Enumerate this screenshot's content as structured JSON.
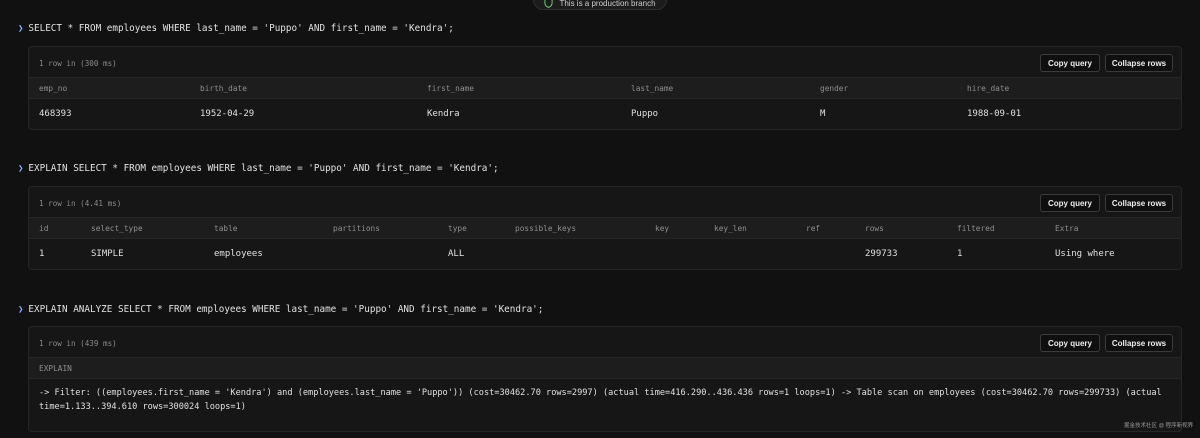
{
  "banner": {
    "text": "This is a production branch",
    "icon": "shield-icon"
  },
  "queries": [
    {
      "sql": "SELECT * FROM employees WHERE last_name = 'Puppo' AND first_name = 'Kendra';",
      "meta": "1 row in (300 ms)",
      "copy_label": "Copy query",
      "collapse_label": "Collapse rows",
      "columns": [
        "emp_no",
        "birth_date",
        "first_name",
        "last_name",
        "gender",
        "hire_date"
      ],
      "rows": [
        [
          "468393",
          "1952-04-29",
          "Kendra",
          "Puppo",
          "M",
          "1988-09-01"
        ]
      ]
    },
    {
      "sql": "EXPLAIN SELECT * FROM employees WHERE last_name = 'Puppo' AND first_name = 'Kendra';",
      "meta": "1 row in (4.41 ms)",
      "copy_label": "Copy query",
      "collapse_label": "Collapse rows",
      "columns": [
        "id",
        "select_type",
        "table",
        "partitions",
        "type",
        "possible_keys",
        "key",
        "key_len",
        "ref",
        "rows",
        "filtered",
        "Extra"
      ],
      "rows": [
        [
          "1",
          "SIMPLE",
          "employees",
          "",
          "ALL",
          "",
          "",
          "",
          "",
          "299733",
          "1",
          "Using where"
        ]
      ]
    },
    {
      "sql": "EXPLAIN ANALYZE SELECT * FROM employees WHERE last_name = 'Puppo' AND first_name = 'Kendra';",
      "meta": "1 row in (439 ms)",
      "copy_label": "Copy query",
      "collapse_label": "Collapse rows",
      "columns": [
        "EXPLAIN"
      ],
      "explain_output": "-> Filter: ((employees.first_name = 'Kendra') and (employees.last_name = 'Puppo')) (cost=30462.70 rows=2997) (actual time=416.290..436.436 rows=1 loops=1) -> Table scan on employees (cost=30462.70 rows=299733) (actual time=1.133..394.610 rows=300024 loops=1)"
    }
  ],
  "watermark": "掘金技术社区 @ 程序新视界",
  "colors": {
    "background": "#111111",
    "panel": "#161616",
    "header": "#1d1d1d",
    "prompt": "#8fb0ff"
  }
}
